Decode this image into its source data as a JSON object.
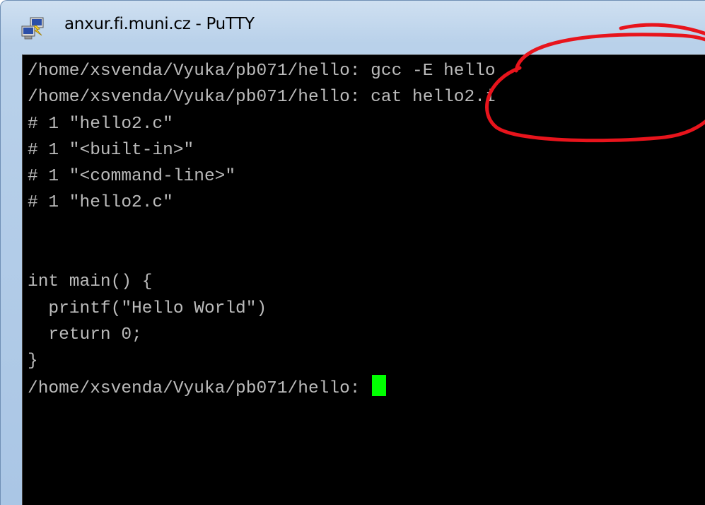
{
  "window": {
    "title": "anxur.fi.muni.cz - PuTTY",
    "icon": "putty-icon"
  },
  "terminal": {
    "lines": [
      "/home/xsvenda/Vyuka/pb071/hello: gcc -E hello",
      "/home/xsvenda/Vyuka/pb071/hello: cat hello2.i",
      "# 1 \"hello2.c\"",
      "# 1 \"<built-in>\"",
      "# 1 \"<command-line>\"",
      "# 1 \"hello2.c\"",
      "",
      "",
      "int main() {",
      "  printf(\"Hello World\")",
      "  return 0;",
      "}",
      "/home/xsvenda/Vyuka/pb071/hello: "
    ],
    "cursor_color": "#00ff00",
    "text_color": "#bbbbbb",
    "background_color": "#000000"
  },
  "annotation": {
    "shape": "hand-drawn-ellipse",
    "color": "#e8141c"
  }
}
